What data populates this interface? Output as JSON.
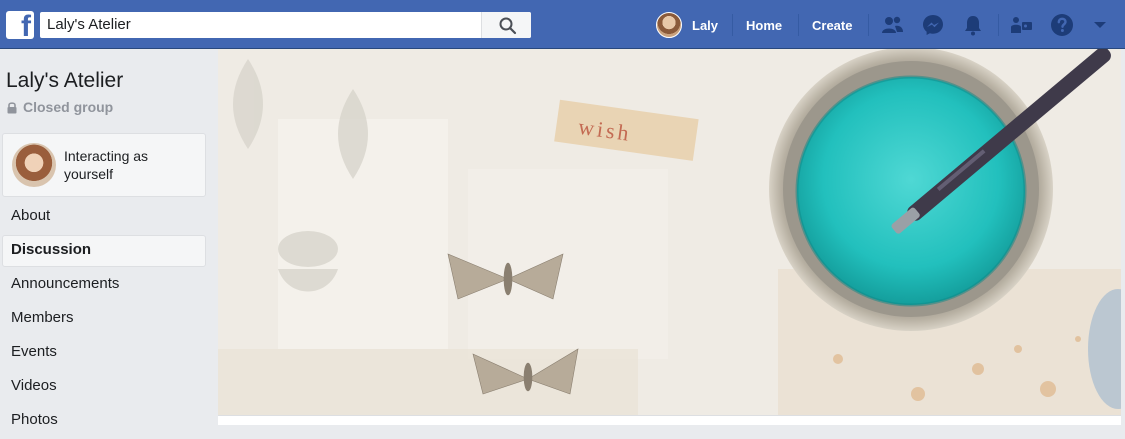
{
  "topbar": {
    "search_value": "Laly's Atelier",
    "profile_name": "Laly",
    "home_label": "Home",
    "create_label": "Create",
    "brand_color": "#4267b2"
  },
  "sidebar": {
    "group_name": "Laly's Atelier",
    "privacy": "Closed group",
    "interacting_as": "Interacting as yourself",
    "items": [
      {
        "label": "About"
      },
      {
        "label": "Discussion",
        "active": true
      },
      {
        "label": "Announcements"
      },
      {
        "label": "Members"
      },
      {
        "label": "Events"
      },
      {
        "label": "Videos"
      },
      {
        "label": "Photos"
      }
    ]
  },
  "cover": {
    "label_on_image": "wish"
  }
}
